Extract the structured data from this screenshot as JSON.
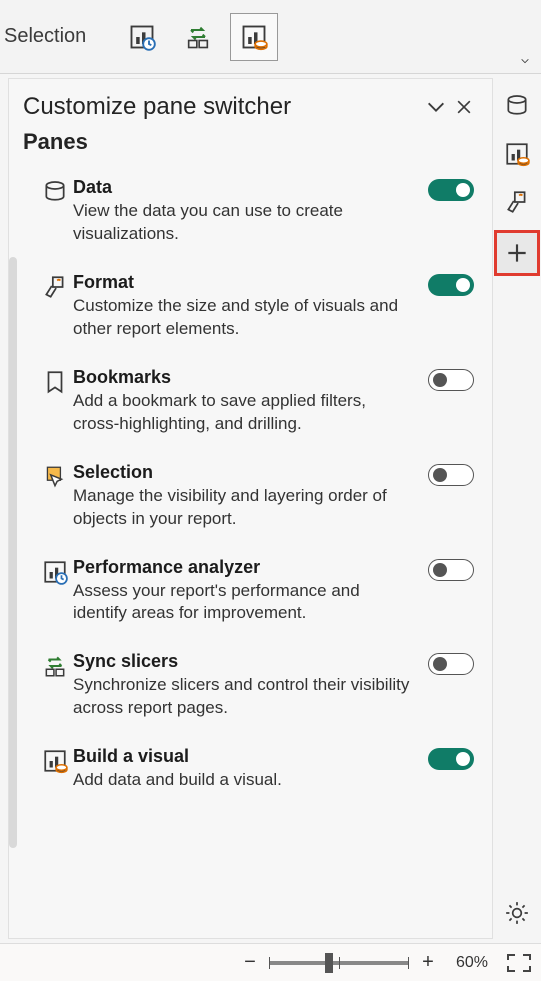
{
  "ribbon": {
    "group_label": "Selection",
    "buttons": [
      {
        "name": "performance-analyzer-ribbon-button"
      },
      {
        "name": "sync-slicers-ribbon-button"
      },
      {
        "name": "build-visual-ribbon-button"
      }
    ]
  },
  "popup": {
    "title": "Customize pane switcher",
    "section": "Panes",
    "items": [
      {
        "key": "data",
        "title": "Data",
        "desc": "View the data you can use to create visualizations.",
        "on": true
      },
      {
        "key": "format",
        "title": "Format",
        "desc": "Customize the size and style of visuals and other report elements.",
        "on": true
      },
      {
        "key": "bookmarks",
        "title": "Bookmarks",
        "desc": "Add a bookmark to save applied filters, cross-highlighting, and drilling.",
        "on": false
      },
      {
        "key": "selection",
        "title": "Selection",
        "desc": "Manage the visibility and layering order of objects in your report.",
        "on": false
      },
      {
        "key": "performance-analyzer",
        "title": "Performance analyzer",
        "desc": "Assess your report's performance and identify areas for improvement.",
        "on": false
      },
      {
        "key": "sync-slicers",
        "title": "Sync slicers",
        "desc": "Synchronize slicers and control their visibility across report pages.",
        "on": false
      },
      {
        "key": "build-visual",
        "title": "Build a visual",
        "desc": "Add data and build a visual.",
        "on": true
      }
    ]
  },
  "rail": {
    "buttons": [
      {
        "name": "data-pane-button"
      },
      {
        "name": "build-visual-pane-button"
      },
      {
        "name": "format-pane-button"
      },
      {
        "name": "add-pane-button",
        "highlight": true
      }
    ]
  },
  "status": {
    "zoom_level": "60%"
  }
}
